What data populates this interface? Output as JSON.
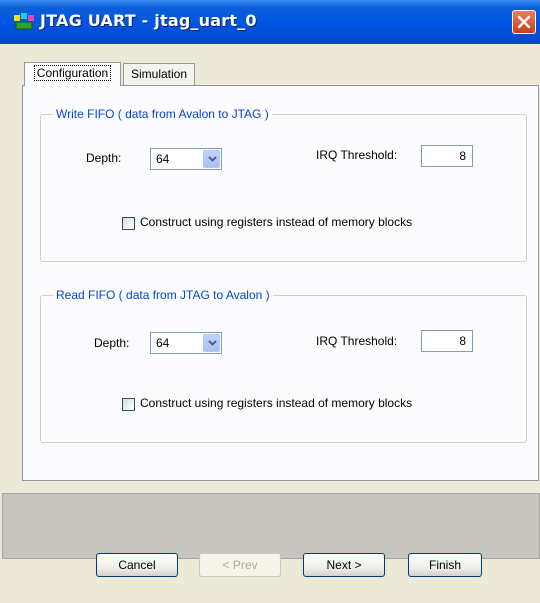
{
  "window": {
    "title": "JTAG UART - jtag_uart_0",
    "icon": "jtag-component-icon",
    "close_icon": "close-icon"
  },
  "tabs": [
    {
      "label": "Configuration",
      "selected": true
    },
    {
      "label": "Simulation",
      "selected": false
    }
  ],
  "write_fifo": {
    "legend": "Write FIFO ( data from Avalon to JTAG )",
    "depth_label": "Depth:",
    "depth_value": "64",
    "irq_label": "IRQ Threshold:",
    "irq_value": "8",
    "checkbox_label": "Construct using registers instead of memory blocks",
    "checkbox_checked": false
  },
  "read_fifo": {
    "legend": "Read FIFO ( data from JTAG to Avalon )",
    "depth_label": "Depth:",
    "depth_value": "64",
    "irq_label": "IRQ Threshold:",
    "irq_value": "8",
    "checkbox_label": "Construct using registers instead of memory blocks",
    "checkbox_checked": false
  },
  "buttons": {
    "cancel": "Cancel",
    "prev": "< Prev",
    "next": "Next >",
    "finish": "Finish"
  },
  "colors": {
    "titlebar": "#0054e3",
    "legend_text": "#0046d5",
    "window_bg": "#ece9d8"
  }
}
